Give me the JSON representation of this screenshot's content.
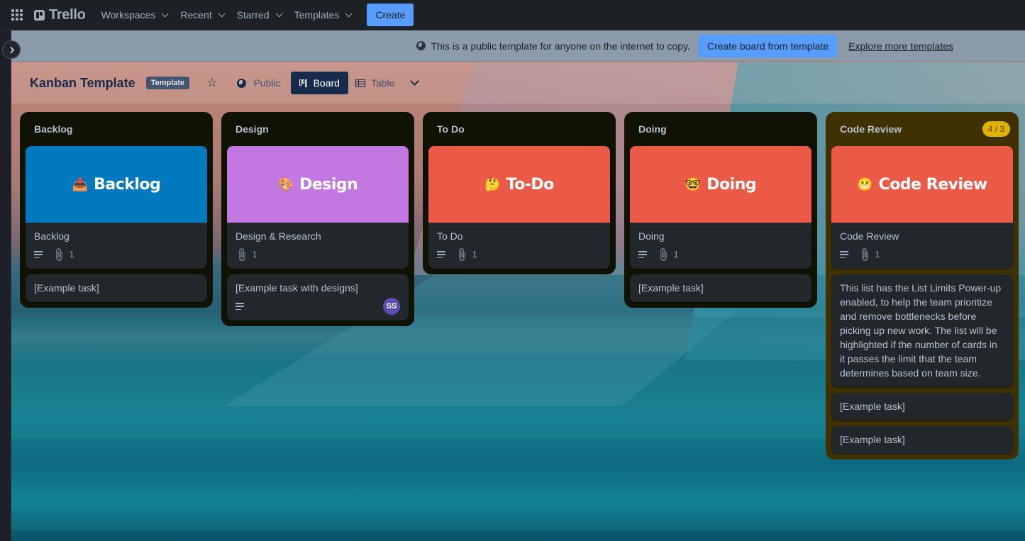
{
  "topnav": {
    "logo": "Trello",
    "menus": [
      {
        "label": "Workspaces"
      },
      {
        "label": "Recent"
      },
      {
        "label": "Starred"
      },
      {
        "label": "Templates"
      }
    ],
    "create_label": "Create"
  },
  "banner": {
    "text": "This is a public template for anyone on the internet to copy.",
    "create_button": "Create board from template",
    "explore_link": "Explore more templates"
  },
  "board_header": {
    "title": "Kanban Template",
    "badge": "Template",
    "visibility": "Public",
    "views": [
      {
        "label": "Board",
        "active": true
      },
      {
        "label": "Table",
        "active": false
      }
    ]
  },
  "lists": [
    {
      "title": "Backlog",
      "cards": [
        {
          "cover_color": "#0079bf",
          "cover_emoji": "📥",
          "cover_text": "Backlog",
          "title": "Backlog",
          "has_description": true,
          "attachments": "1"
        },
        {
          "title": "[Example task]"
        }
      ]
    },
    {
      "title": "Design",
      "cards": [
        {
          "cover_color": "#c377e0",
          "cover_emoji": "🎨",
          "cover_text": "Design",
          "title": "Design & Research",
          "has_description": false,
          "attachments": "1"
        },
        {
          "title": "[Example task with designs]",
          "has_description": true,
          "member": "SS"
        }
      ]
    },
    {
      "title": "To Do",
      "cards": [
        {
          "cover_color": "#eb5a46",
          "cover_emoji": "🤔",
          "cover_text": "To-Do",
          "title": "To Do",
          "has_description": true,
          "attachments": "1"
        }
      ]
    },
    {
      "title": "Doing",
      "cards": [
        {
          "cover_color": "#eb5a46",
          "cover_emoji": "🤓",
          "cover_text": "Doing",
          "title": "Doing",
          "has_description": true,
          "attachments": "1"
        },
        {
          "title": "[Example task]"
        }
      ]
    },
    {
      "title": "Code Review",
      "limit_badge": "4 / 3",
      "cards": [
        {
          "cover_color": "#eb5a46",
          "cover_emoji": "😬",
          "cover_text": "Code Review",
          "title": "Code Review",
          "has_description": true,
          "attachments": "1"
        },
        {
          "title": "This list has the List Limits Power-up enabled, to help the team prioritize and remove bottlenecks before picking up new work. The list will be highlighted if the number of cards in it passes the limit that the team determines based on team size."
        },
        {
          "title": "[Example task]"
        },
        {
          "title": "[Example task]"
        }
      ]
    }
  ]
}
